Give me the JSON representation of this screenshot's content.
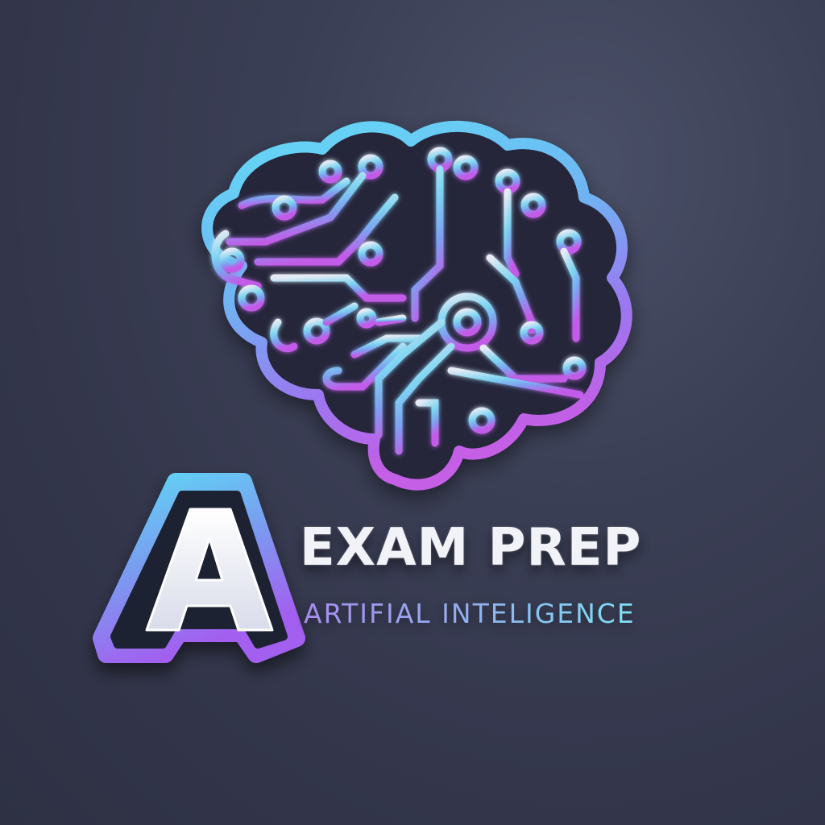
{
  "logo": {
    "title": "EXAM PREP",
    "subtitle": "ARTIFIAL INTELIGENCE",
    "badge_letter": "A",
    "icon": "brain-circuit-icon"
  },
  "colors": {
    "background": "#373a50",
    "accent_cyan": "#5ed8f5",
    "accent_blue": "#7aa6f0",
    "accent_purple": "#a35ff0",
    "accent_magenta": "#c25ce8",
    "text_white": "#f2f3f8"
  }
}
